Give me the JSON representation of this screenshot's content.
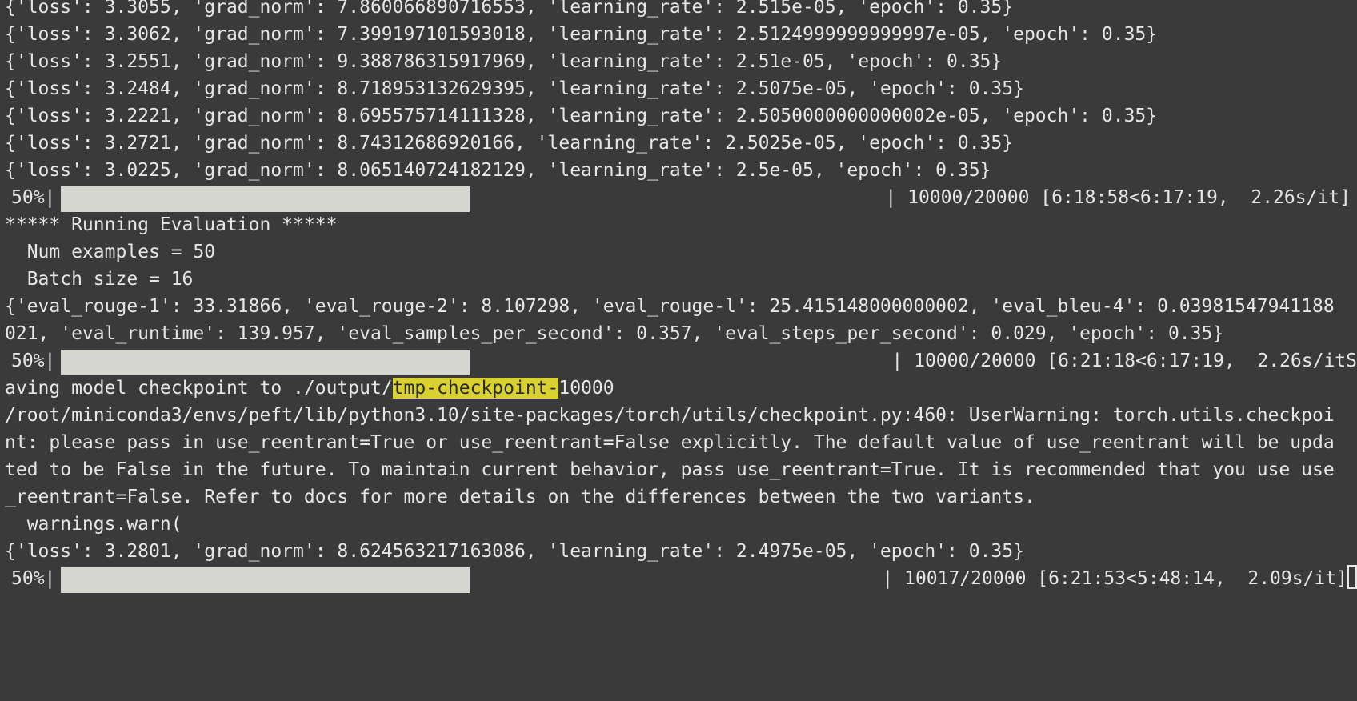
{
  "terminal": {
    "train_logs": [
      "{'loss': 3.3055, 'grad_norm': 7.860066890716553, 'learning_rate': 2.515e-05, 'epoch': 0.35}",
      "{'loss': 3.3062, 'grad_norm': 7.399197101593018, 'learning_rate': 2.5124999999999997e-05, 'epoch': 0.35}",
      "{'loss': 3.2551, 'grad_norm': 9.388786315917969, 'learning_rate': 2.51e-05, 'epoch': 0.35}",
      "{'loss': 3.2484, 'grad_norm': 8.718953132629395, 'learning_rate': 2.5075e-05, 'epoch': 0.35}",
      "{'loss': 3.2221, 'grad_norm': 8.695575714111328, 'learning_rate': 2.5050000000000002e-05, 'epoch': 0.35}",
      "{'loss': 3.2721, 'grad_norm': 8.74312686920166, 'learning_rate': 2.5025e-05, 'epoch': 0.35}",
      "{'loss': 3.0225, 'grad_norm': 8.065140724182129, 'learning_rate': 2.5e-05, 'epoch': 0.35}"
    ],
    "progress_1": {
      "percent_label": "50%|",
      "fraction": 0.5,
      "right_text": "| 10000/20000 [6:18:58<6:17:19,  2.26s/it]"
    },
    "eval": {
      "header": "***** Running Evaluation *****",
      "num_examples": "  Num examples = 50",
      "batch_size": "  Batch size = 16",
      "result_line_1": "{'eval_rouge-1': 33.31866, 'eval_rouge-2': 8.107298, 'eval_rouge-l': 25.415148000000002, 'eval_bleu-4': 0.03981547941188",
      "result_line_2": "021, 'eval_runtime': 139.957, 'eval_samples_per_second': 0.357, 'eval_steps_per_second': 0.029, 'epoch': 0.35}"
    },
    "progress_2": {
      "percent_label": "50%|",
      "fraction": 0.5,
      "right_text": "| 10000/20000 [6:21:18<6:17:19,  2.26s/itS"
    },
    "saving": {
      "prefix": "aving model checkpoint to ./output/",
      "highlight": "tmp-checkpoint-",
      "suffix": "10000"
    },
    "warning_lines": [
      "/root/miniconda3/envs/peft/lib/python3.10/site-packages/torch/utils/checkpoint.py:460: UserWarning: torch.utils.checkpoi",
      "nt: please pass in use_reentrant=True or use_reentrant=False explicitly. The default value of use_reentrant will be upda",
      "ted to be False in the future. To maintain current behavior, pass use_reentrant=True. It is recommended that you use use",
      "_reentrant=False. Refer to docs for more details on the differences between the two variants.",
      "  warnings.warn("
    ],
    "final_log": "{'loss': 3.2801, 'grad_norm': 8.624563217163086, 'learning_rate': 2.4975e-05, 'epoch': 0.35}",
    "progress_3": {
      "percent_label": "50%|",
      "fraction": 0.5,
      "right_text": "| 10017/20000 [6:21:53<5:48:14,  2.09s/it]"
    }
  }
}
